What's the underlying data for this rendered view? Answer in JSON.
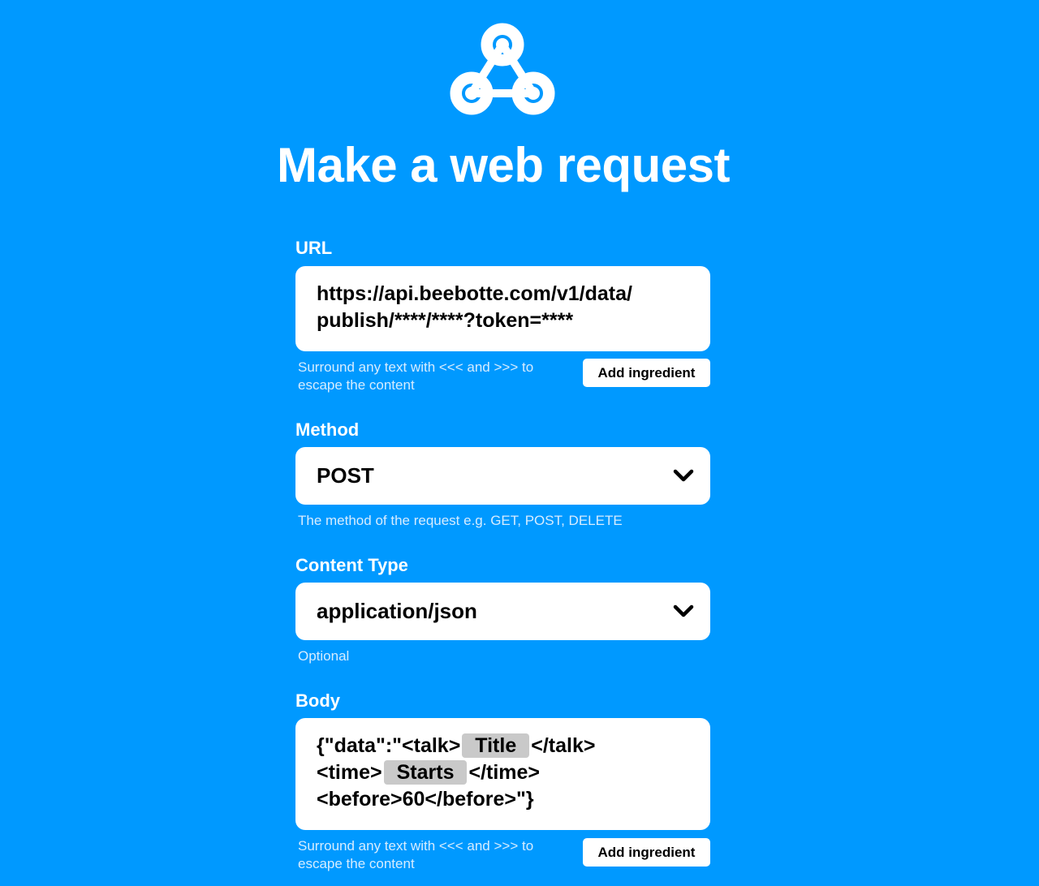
{
  "page": {
    "title": "Make a web request",
    "logo_icon": "webhooks-icon"
  },
  "colors": {
    "background": "#0099ff",
    "field_background": "#ffffff",
    "help_text": "#d6ecff",
    "ingredient_pill": "#c9c9c9"
  },
  "url": {
    "label": "URL",
    "line1": "https://api.beebotte.com/v1/data/",
    "line2": "publish/****/****?token=****",
    "help_line1": "Surround any text with <<< and >>> to",
    "help_line2": "escape the content",
    "add_ingredient": "Add ingredient"
  },
  "method": {
    "label": "Method",
    "value": "POST",
    "help": "The method of the request e.g. GET, POST, DELETE",
    "icon": "chevron-down-icon"
  },
  "content_type": {
    "label": "Content Type",
    "value": "application/json",
    "help": "Optional",
    "icon": "chevron-down-icon"
  },
  "body": {
    "label": "Body",
    "line1_prefix": "{\"data\":\"<talk>",
    "ingredient_title": "Title",
    "line1_suffix": "</talk>",
    "line2_prefix": "<time>",
    "ingredient_starts": "Starts",
    "line2_suffix": "</time>",
    "line3": "<before>60</before>\"}",
    "help_line1": "Surround any text with <<< and >>> to",
    "help_line2": "escape the content",
    "add_ingredient": "Add ingredient"
  }
}
